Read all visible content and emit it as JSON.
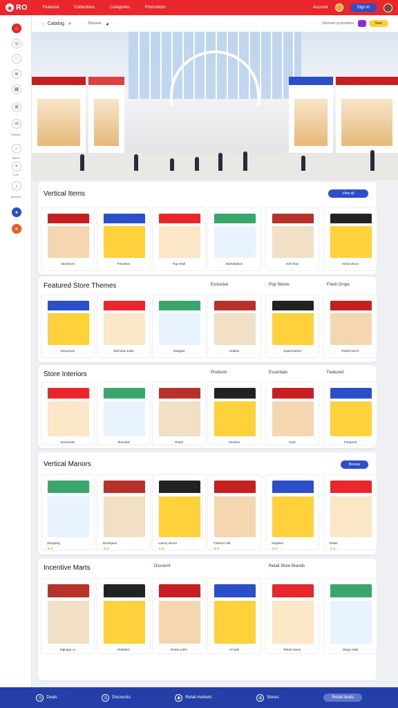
{
  "topbar": {
    "logo": "RO",
    "nav": [
      "Featured",
      "Collections",
      "Categories",
      "Promotions"
    ],
    "right_text": "Account",
    "signin": "Sign in"
  },
  "sidebar": {
    "labels": [
      "Explore",
      "Stores",
      "Live",
      "Account"
    ]
  },
  "search": {
    "brand": "Catalog",
    "mid": "Discover",
    "right": "Discover promotions",
    "badge": "New"
  },
  "sections": [
    {
      "title": "Vertical Items",
      "button": "View all"
    },
    {
      "title": "Featured Store Themes",
      "sub": [
        "Exclusive",
        "Pop Stores",
        "Fresh Drops"
      ]
    },
    {
      "title": "Store Interiors",
      "sub": [
        "Products",
        "Essentials",
        "Featured"
      ]
    },
    {
      "title": "Vertical Manors",
      "button": "Browse"
    },
    {
      "title": "Incentive Marts",
      "sub": [
        "Discount",
        "Retail Store Brands"
      ]
    }
  ],
  "row1": [
    "Storefront",
    "Favorites",
    "Top retail",
    "Marketplace",
    "Gift shop",
    "Home decor"
  ],
  "row2": [
    "Emporium",
    "Mall and outlet",
    "Gadgets",
    "Outlets",
    "Supermarket",
    "Retail merch"
  ],
  "row3": [
    "Essentials",
    "Branded",
    "Retail",
    "Vendors",
    "Gear",
    "Featured"
  ],
  "row4": [
    "Shopping",
    "Boutiques",
    "Luxury stores",
    "Fashion hall",
    "Supplies",
    "Retail"
  ],
  "row5": [
    "Signage co",
    "Retailers",
    "Retail outlet",
    "Arcade",
    "Retail stores",
    "Mega retail"
  ],
  "bottombar": [
    "Deals",
    "Discounts",
    "Retail markets",
    "Stores",
    "Retail deals"
  ],
  "colors": {
    "accent": "#e8262b",
    "primary": "#2b4fc9",
    "footer": "#2440a8"
  }
}
